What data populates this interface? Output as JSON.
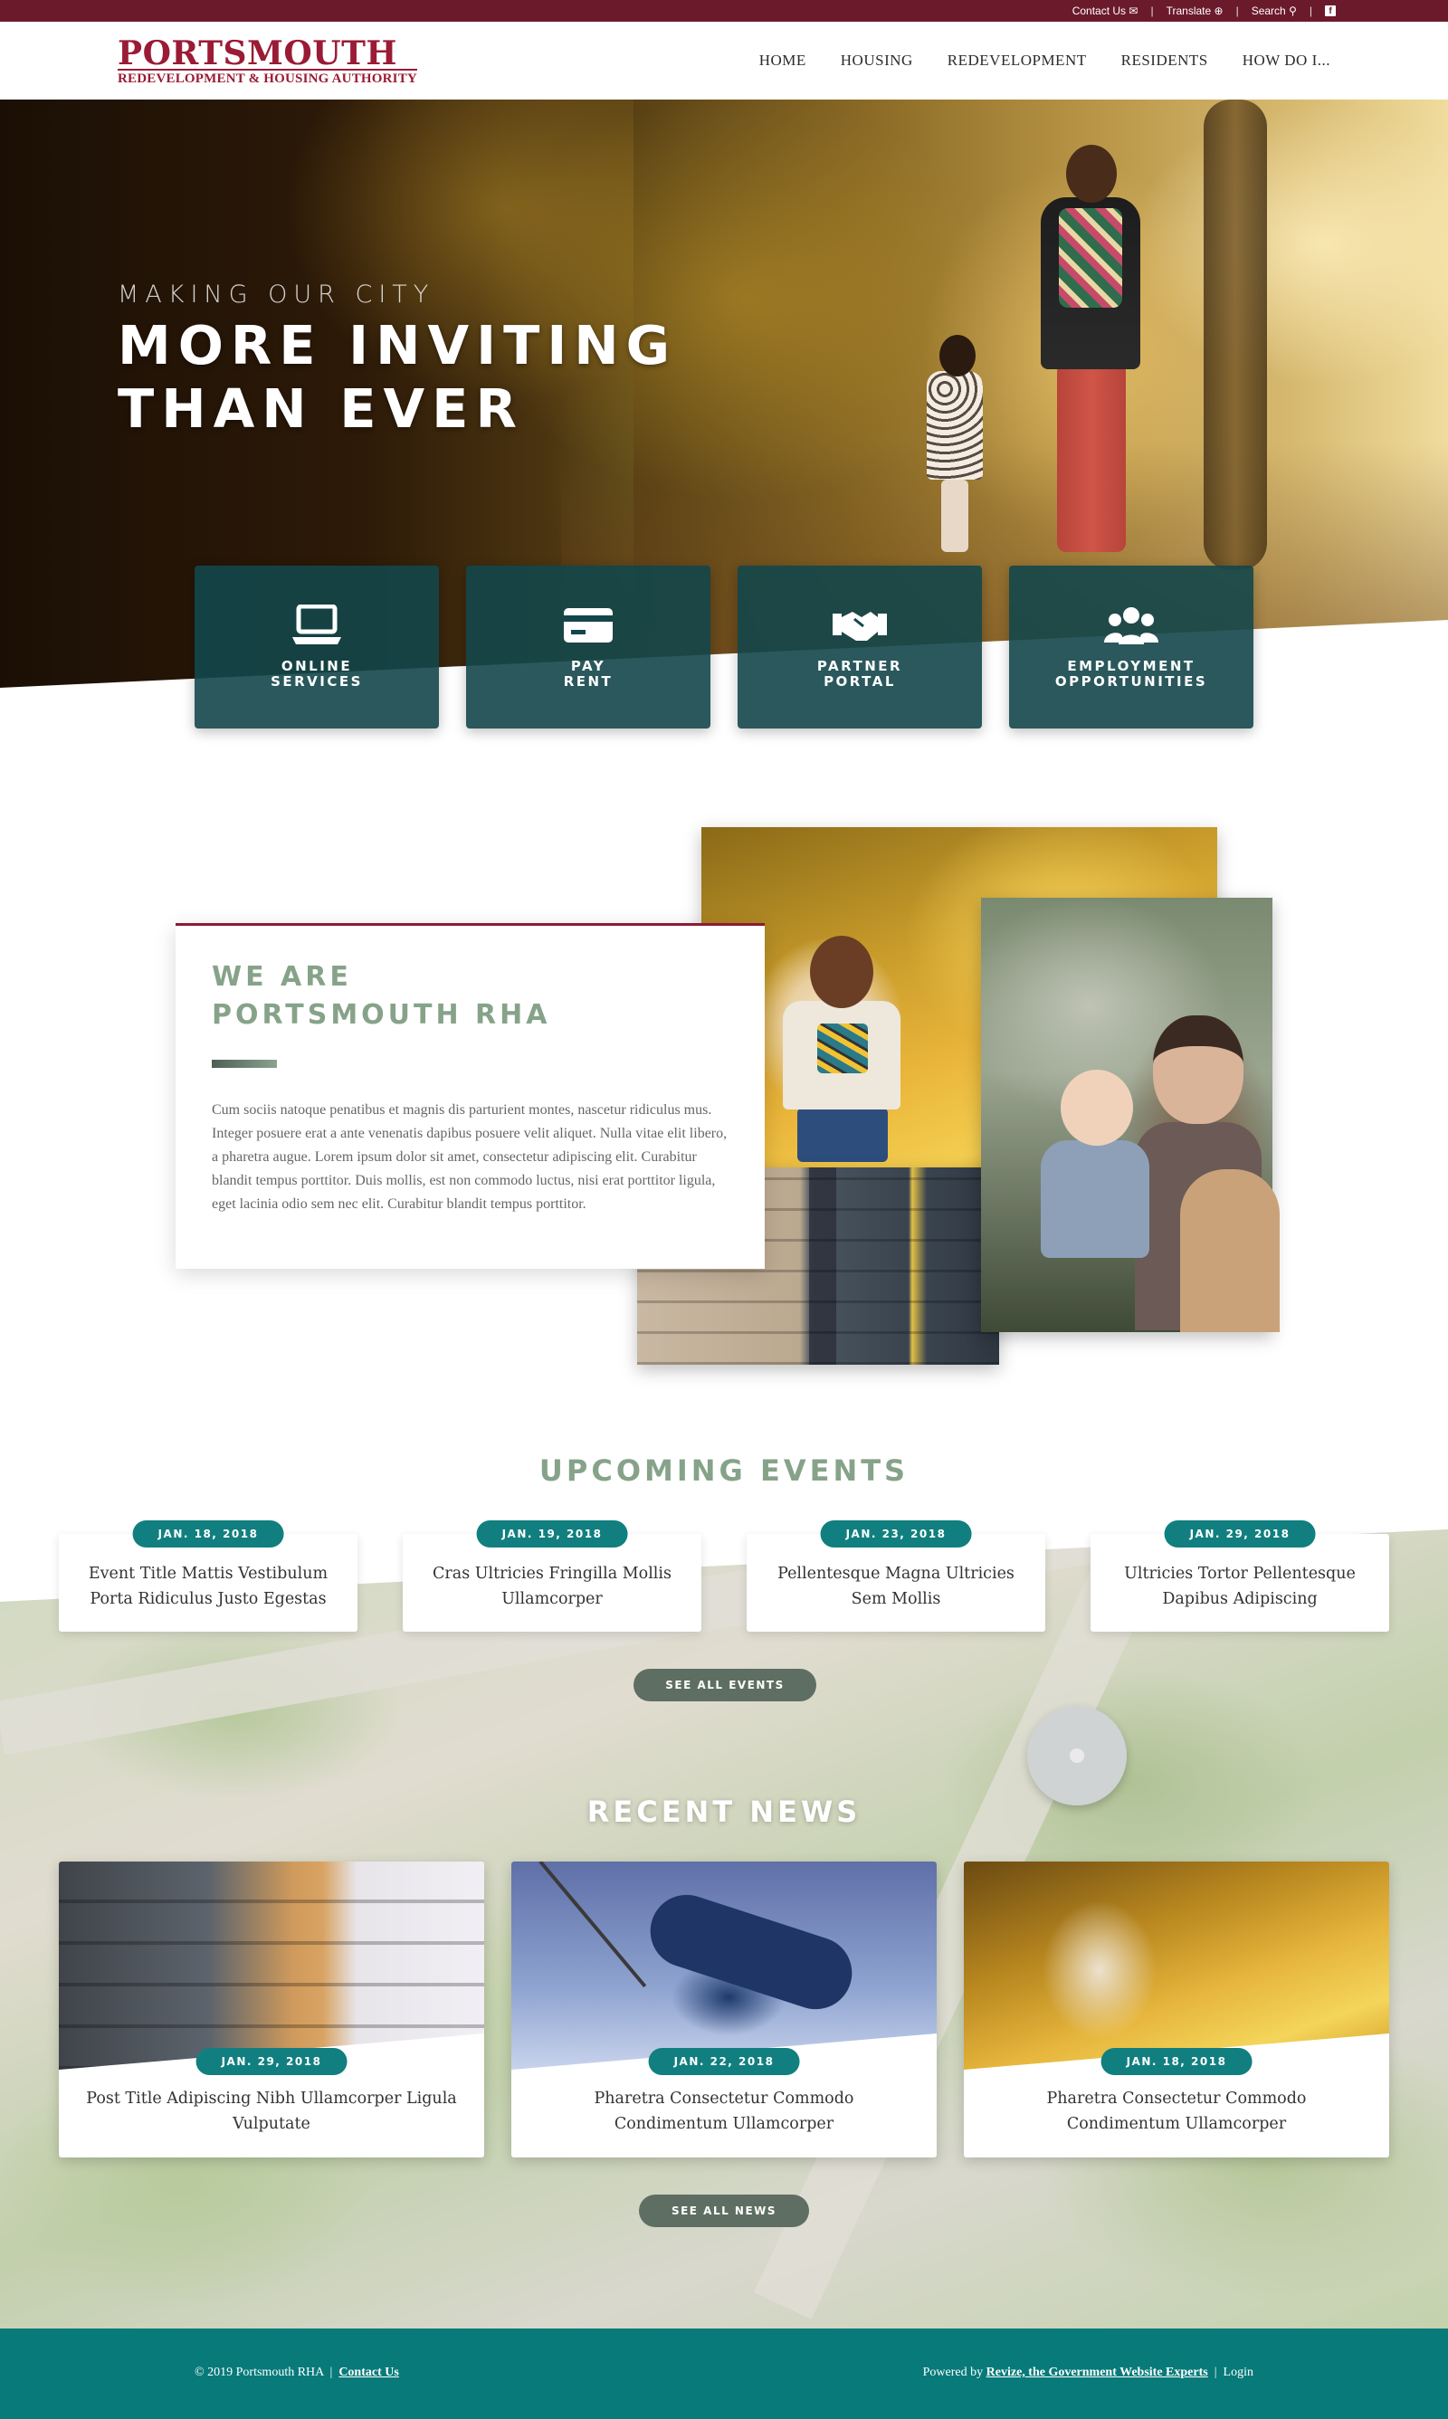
{
  "utility": {
    "contact": "Contact Us",
    "translate": "Translate",
    "search": "Search",
    "facebook": "f"
  },
  "logo": {
    "line1": "PORTSMOUTH",
    "line2": "REDEVELOPMENT & HOUSING AUTHORITY"
  },
  "nav": [
    "HOME",
    "HOUSING",
    "REDEVELOPMENT",
    "RESIDENTS",
    "HOW DO I..."
  ],
  "hero": {
    "kicker": "MAKING OUR CITY",
    "line1": "MORE INVITING",
    "line2": "THAN EVER"
  },
  "quick_links": [
    {
      "label": "ONLINE\nSERVICES",
      "icon": "laptop-icon"
    },
    {
      "label": "PAY\nRENT",
      "icon": "credit-card-icon"
    },
    {
      "label": "PARTNER\nPORTAL",
      "icon": "handshake-icon"
    },
    {
      "label": "EMPLOYMENT\nOPPORTUNITIES",
      "icon": "users-icon"
    }
  ],
  "about": {
    "heading_line1": "WE ARE",
    "heading_line2": "PORTSMOUTH RHA",
    "body": "Cum sociis natoque penatibus et magnis dis parturient montes, nascetur ridiculus mus. Integer posuere erat a ante venenatis dapibus posuere velit aliquet. Nulla vitae elit libero, a pharetra augue. Lorem ipsum dolor sit amet, consectetur adipiscing elit. Curabitur blandit tempus porttitor. Duis mollis, est non commodo luctus, nisi erat porttitor ligula, eget lacinia odio sem nec elit. Curabitur blandit tempus porttitor."
  },
  "events": {
    "title": "UPCOMING EVENTS",
    "items": [
      {
        "date": "JAN. 18, 2018",
        "title": "Event Title Mattis Vestibulum Porta Ridiculus Justo Egestas"
      },
      {
        "date": "JAN. 19, 2018",
        "title": "Cras Ultricies Fringilla Mollis Ullamcorper"
      },
      {
        "date": "JAN. 23, 2018",
        "title": "Pellentesque Magna Ultricies Sem Mollis"
      },
      {
        "date": "JAN. 29, 2018",
        "title": "Ultricies Tortor Pellentesque Dapibus Adipiscing"
      }
    ],
    "button": "SEE ALL EVENTS"
  },
  "news": {
    "title": "RECENT NEWS",
    "items": [
      {
        "date": "JAN. 29, 2018",
        "title": "Post Title Adipiscing Nibh Ullamcorper Ligula Vulputate"
      },
      {
        "date": "JAN. 22, 2018",
        "title": "Pharetra Consectetur Commodo Condimentum Ullamcorper"
      },
      {
        "date": "JAN. 18, 2018",
        "title": "Pharetra Consectetur Commodo Condimentum Ullamcorper"
      }
    ],
    "button": "SEE ALL NEWS"
  },
  "footer": {
    "copyright": "© 2019 Portsmouth RHA",
    "contact_link": "Contact Us",
    "powered_prefix": "Powered by",
    "powered_link": "Revize, the Government Website Experts",
    "login": "Login"
  },
  "colors": {
    "brand_maroon": "#6b1a2c",
    "teal": "#117f7f",
    "sage_heading": "#86a38a",
    "footer_teal": "#087a7a"
  }
}
